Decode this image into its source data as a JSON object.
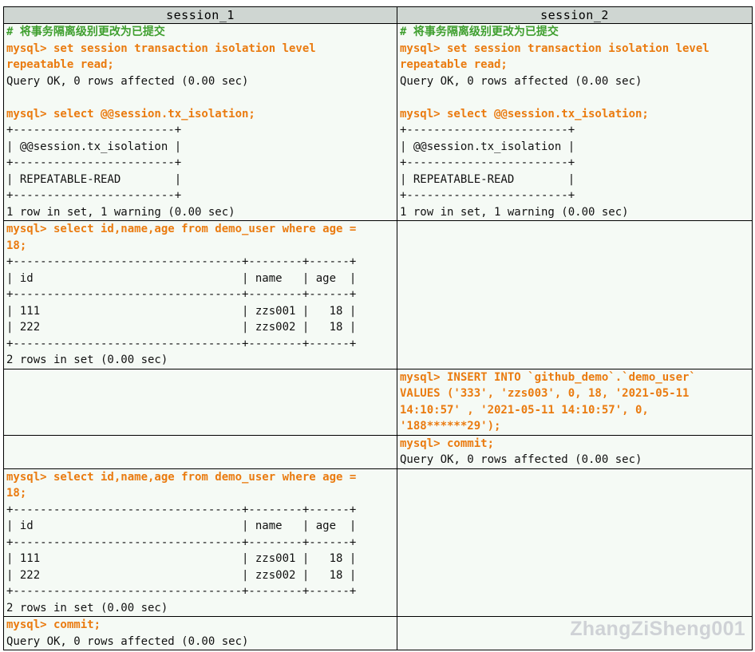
{
  "headers": {
    "left": "session_1",
    "right": "session_2"
  },
  "watermark": "ZhangZiSheng001",
  "rows": [
    {
      "left": [
        {
          "t": "cm",
          "v": "# 将事务隔离级别更改为已提交"
        },
        {
          "t": "cmd",
          "v": "mysql> set session transaction isolation level"
        },
        {
          "t": "cmd",
          "v": "repeatable read;"
        },
        {
          "t": "out",
          "v": "Query OK, 0 rows affected (0.00 sec)"
        },
        {
          "t": "out",
          "v": ""
        },
        {
          "t": "cmd",
          "v": "mysql> select @@session.tx_isolation;"
        },
        {
          "t": "out",
          "v": "+------------------------+"
        },
        {
          "t": "out",
          "v": "| @@session.tx_isolation |"
        },
        {
          "t": "out",
          "v": "+------------------------+"
        },
        {
          "t": "out",
          "v": "| REPEATABLE-READ        |"
        },
        {
          "t": "out",
          "v": "+------------------------+"
        },
        {
          "t": "out",
          "v": "1 row in set, 1 warning (0.00 sec)"
        }
      ],
      "right": [
        {
          "t": "cm",
          "v": "# 将事务隔离级别更改为已提交"
        },
        {
          "t": "cmd",
          "v": "mysql> set session transaction isolation level"
        },
        {
          "t": "cmd",
          "v": "repeatable read;"
        },
        {
          "t": "out",
          "v": "Query OK, 0 rows affected (0.00 sec)"
        },
        {
          "t": "out",
          "v": ""
        },
        {
          "t": "cmd",
          "v": "mysql> select @@session.tx_isolation;"
        },
        {
          "t": "out",
          "v": "+------------------------+"
        },
        {
          "t": "out",
          "v": "| @@session.tx_isolation |"
        },
        {
          "t": "out",
          "v": "+------------------------+"
        },
        {
          "t": "out",
          "v": "| REPEATABLE-READ        |"
        },
        {
          "t": "out",
          "v": "+------------------------+"
        },
        {
          "t": "out",
          "v": "1 row in set, 1 warning (0.00 sec)"
        }
      ]
    },
    {
      "left": [
        {
          "t": "cmd",
          "v": "mysql> select id,name,age from demo_user where age ="
        },
        {
          "t": "cmd",
          "v": "18;"
        },
        {
          "t": "out",
          "v": "+----------------------------------+--------+------+"
        },
        {
          "t": "out",
          "v": "| id                               | name   | age  |"
        },
        {
          "t": "out",
          "v": "+----------------------------------+--------+------+"
        },
        {
          "t": "out",
          "v": "| 111                              | zzs001 |   18 |"
        },
        {
          "t": "out",
          "v": "| 222                              | zzs002 |   18 |"
        },
        {
          "t": "out",
          "v": "+----------------------------------+--------+------+"
        },
        {
          "t": "out",
          "v": "2 rows in set (0.00 sec)"
        }
      ],
      "right": []
    },
    {
      "left": [],
      "right": [
        {
          "t": "cmd",
          "v": "mysql> INSERT INTO `github_demo`.`demo_user`"
        },
        {
          "t": "cmd",
          "v": "VALUES ('333', 'zzs003', 0, 18, '2021-05-11"
        },
        {
          "t": "cmd",
          "v": "14:10:57' , '2021-05-11 14:10:57', 0,"
        },
        {
          "t": "cmd",
          "v": "'188******29');"
        }
      ]
    },
    {
      "left": [],
      "right": [
        {
          "t": "cmd",
          "v": "mysql> commit;"
        },
        {
          "t": "out",
          "v": "Query OK, 0 rows affected (0.00 sec)"
        }
      ]
    },
    {
      "left": [
        {
          "t": "cmd",
          "v": "mysql> select id,name,age from demo_user where age ="
        },
        {
          "t": "cmd",
          "v": "18;"
        },
        {
          "t": "out",
          "v": "+----------------------------------+--------+------+"
        },
        {
          "t": "out",
          "v": "| id                               | name   | age  |"
        },
        {
          "t": "out",
          "v": "+----------------------------------+--------+------+"
        },
        {
          "t": "out",
          "v": "| 111                              | zzs001 |   18 |"
        },
        {
          "t": "out",
          "v": "| 222                              | zzs002 |   18 |"
        },
        {
          "t": "out",
          "v": "+----------------------------------+--------+------+"
        },
        {
          "t": "out",
          "v": "2 rows in set (0.00 sec)"
        }
      ],
      "right": []
    },
    {
      "left": [
        {
          "t": "cmd",
          "v": "mysql> commit;"
        },
        {
          "t": "out",
          "v": "Query OK, 0 rows affected (0.00 sec)"
        }
      ],
      "right": []
    }
  ]
}
